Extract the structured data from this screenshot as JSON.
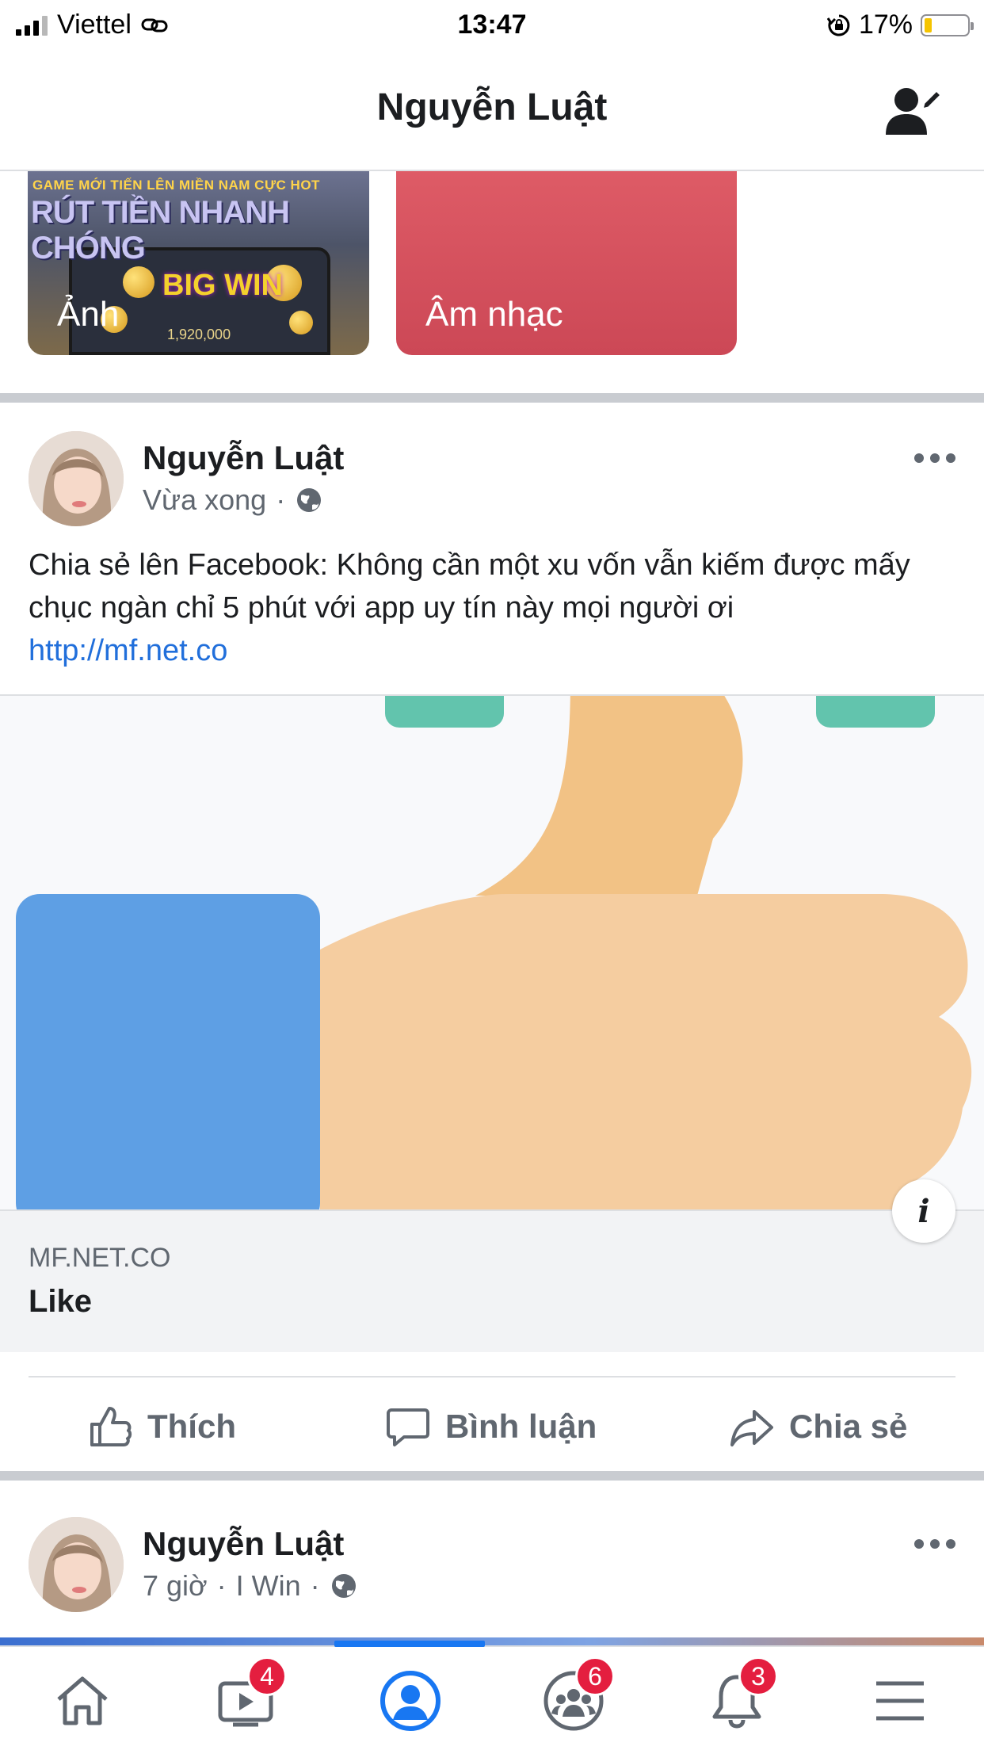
{
  "status_bar": {
    "carrier": "Viettel",
    "time": "13:47",
    "battery": "17%"
  },
  "header": {
    "title": "Nguyễn Luật",
    "action_icon": "edit-profile-icon"
  },
  "tiles": {
    "photo": {
      "label": "Ảnh",
      "banner_line1": "GAME MỚI TIẾN LÊN MIỀN NAM CỰC HOT",
      "banner_line2": "RÚT TIỀN NHANH CHÓNG",
      "bigwin_text": "BIG WIN",
      "bigwin_amount": "1,920,000"
    },
    "music": {
      "label": "Âm nhạc"
    }
  },
  "posts": [
    {
      "author": "Nguyễn Luật",
      "time": "Vừa xong",
      "separator": "·",
      "text": "Chia sẻ lên Facebook: Không cần một xu vốn vẫn kiếm được mấy chục ngàn chỉ 5 phút với app uy tín này mọi người ơi",
      "link": "http://mf.net.co",
      "link_card": {
        "domain": "MF.NET.CO",
        "title": "Like",
        "info_label": "i"
      },
      "actions": {
        "like": "Thích",
        "comment": "Bình luận",
        "share": "Chia sẻ"
      }
    },
    {
      "author": "Nguyễn Luật",
      "time": "7 giờ",
      "separator": "·",
      "app": "I Win",
      "separator2": "·"
    }
  ],
  "tabbar": {
    "home": {
      "icon": "home-icon"
    },
    "watch": {
      "icon": "watch-icon",
      "badge": "4"
    },
    "profile": {
      "icon": "profile-icon",
      "active": true
    },
    "groups": {
      "icon": "groups-icon",
      "badge": "6"
    },
    "notifications": {
      "icon": "bell-icon",
      "badge": "3"
    },
    "menu": {
      "icon": "menu-icon"
    }
  },
  "colors": {
    "accent": "#1877f2",
    "badge": "#e41e3f",
    "link": "#216fdb",
    "music_tile": "#d4505d"
  }
}
